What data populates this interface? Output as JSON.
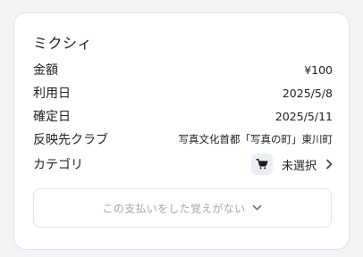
{
  "card": {
    "title": "ミクシィ"
  },
  "rows": {
    "amount": {
      "label": "金額",
      "value": "¥100"
    },
    "use_date": {
      "label": "利用日",
      "value": "2025/5/8"
    },
    "confirm_date": {
      "label": "確定日",
      "value": "2025/5/11"
    },
    "club": {
      "label": "反映先クラブ",
      "value": "写真文化首都「写真の町」東川町"
    },
    "category": {
      "label": "カテゴリ",
      "value": "未選択",
      "icon": "cart-icon"
    }
  },
  "dispute": {
    "label": "この支払いをした覚えがない",
    "icon": "chevron-down-icon"
  },
  "colors": {
    "background": "#f4f4f6",
    "card": "#ffffff",
    "muted_text": "#a6a6ad",
    "icon_bg": "#eceef5"
  }
}
